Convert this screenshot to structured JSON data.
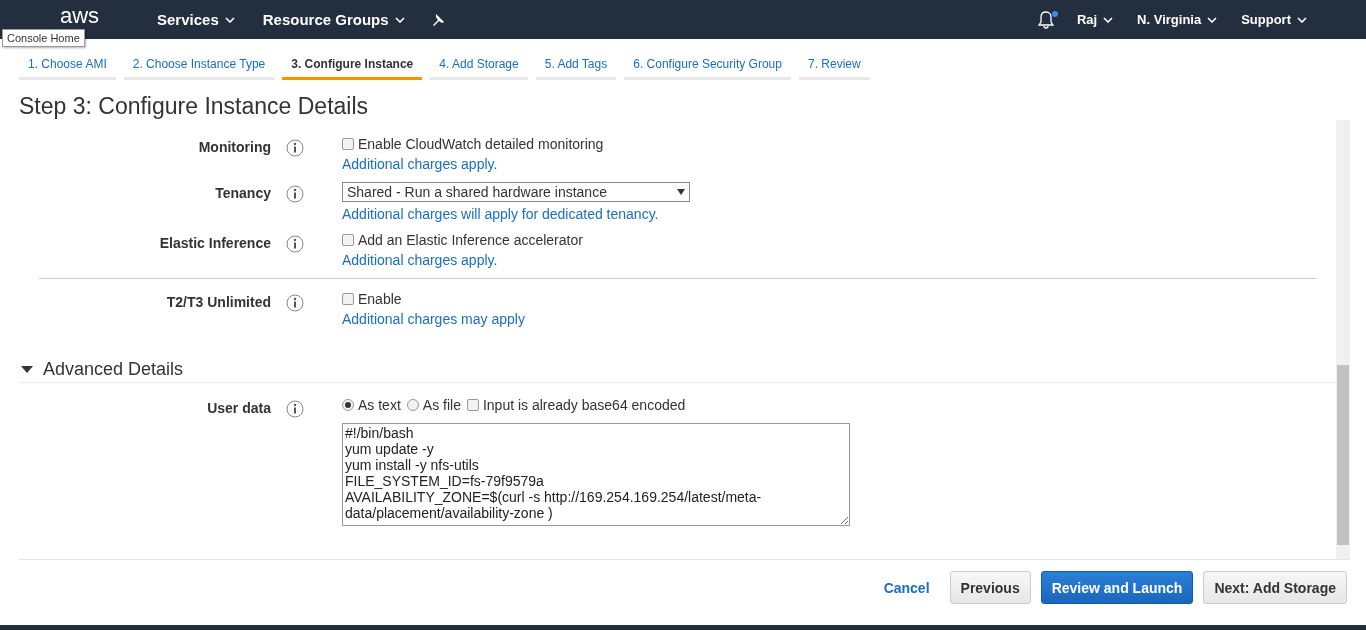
{
  "nav": {
    "logo": "aws",
    "menus": [
      {
        "label": "Services"
      },
      {
        "label": "Resource Groups"
      }
    ],
    "notifications_unread": true,
    "right_menus": [
      {
        "label": "Raj"
      },
      {
        "label": "N. Virginia"
      },
      {
        "label": "Support"
      }
    ]
  },
  "tooltip": "Console Home",
  "steps": [
    {
      "label": "1. Choose AMI",
      "selected": false
    },
    {
      "label": "2. Choose Instance Type",
      "selected": false
    },
    {
      "label": "3. Configure Instance",
      "selected": true
    },
    {
      "label": "4. Add Storage",
      "selected": false
    },
    {
      "label": "5. Add Tags",
      "selected": false
    },
    {
      "label": "6. Configure Security Group",
      "selected": false
    },
    {
      "label": "7. Review",
      "selected": false
    }
  ],
  "title": "Step 3: Configure Instance Details",
  "rows": [
    {
      "kind": "checkbox",
      "label": "Monitoring",
      "option": "Enable CloudWatch detailed monitoring",
      "checked": false,
      "note": "Additional charges apply."
    },
    {
      "kind": "select",
      "label": "Tenancy",
      "value": "Shared - Run a shared hardware instance",
      "note": "Additional charges will apply for dedicated tenancy."
    },
    {
      "kind": "checkbox",
      "label": "Elastic Inference",
      "option": "Add an Elastic Inference accelerator",
      "checked": false,
      "note": "Additional charges apply."
    },
    {
      "kind": "divider"
    },
    {
      "kind": "checkbox",
      "label": "T2/T3 Unlimited",
      "option": "Enable",
      "checked": false,
      "note": "Additional charges may apply"
    }
  ],
  "advanced": {
    "title": "Advanced Details",
    "expanded": true,
    "user_data": {
      "label": "User data",
      "radios": [
        {
          "label": "As text",
          "selected": true
        },
        {
          "label": "As file",
          "selected": false
        }
      ],
      "base64": {
        "label": "Input is already base64 encoded",
        "checked": false
      },
      "lines": [
        "#!/bin/bash",
        "yum update -y",
        "yum install -y nfs-utils",
        "FILE_SYSTEM_ID=fs-79f9579a",
        "AVAILABILITY_ZONE=$(curl -s http://169.254.169.254/latest/meta-",
        "data/placement/availability-zone )"
      ]
    }
  },
  "footer": {
    "cancel": "Cancel",
    "previous": "Previous",
    "primary": "Review and Launch",
    "next": "Next: Add Storage"
  }
}
